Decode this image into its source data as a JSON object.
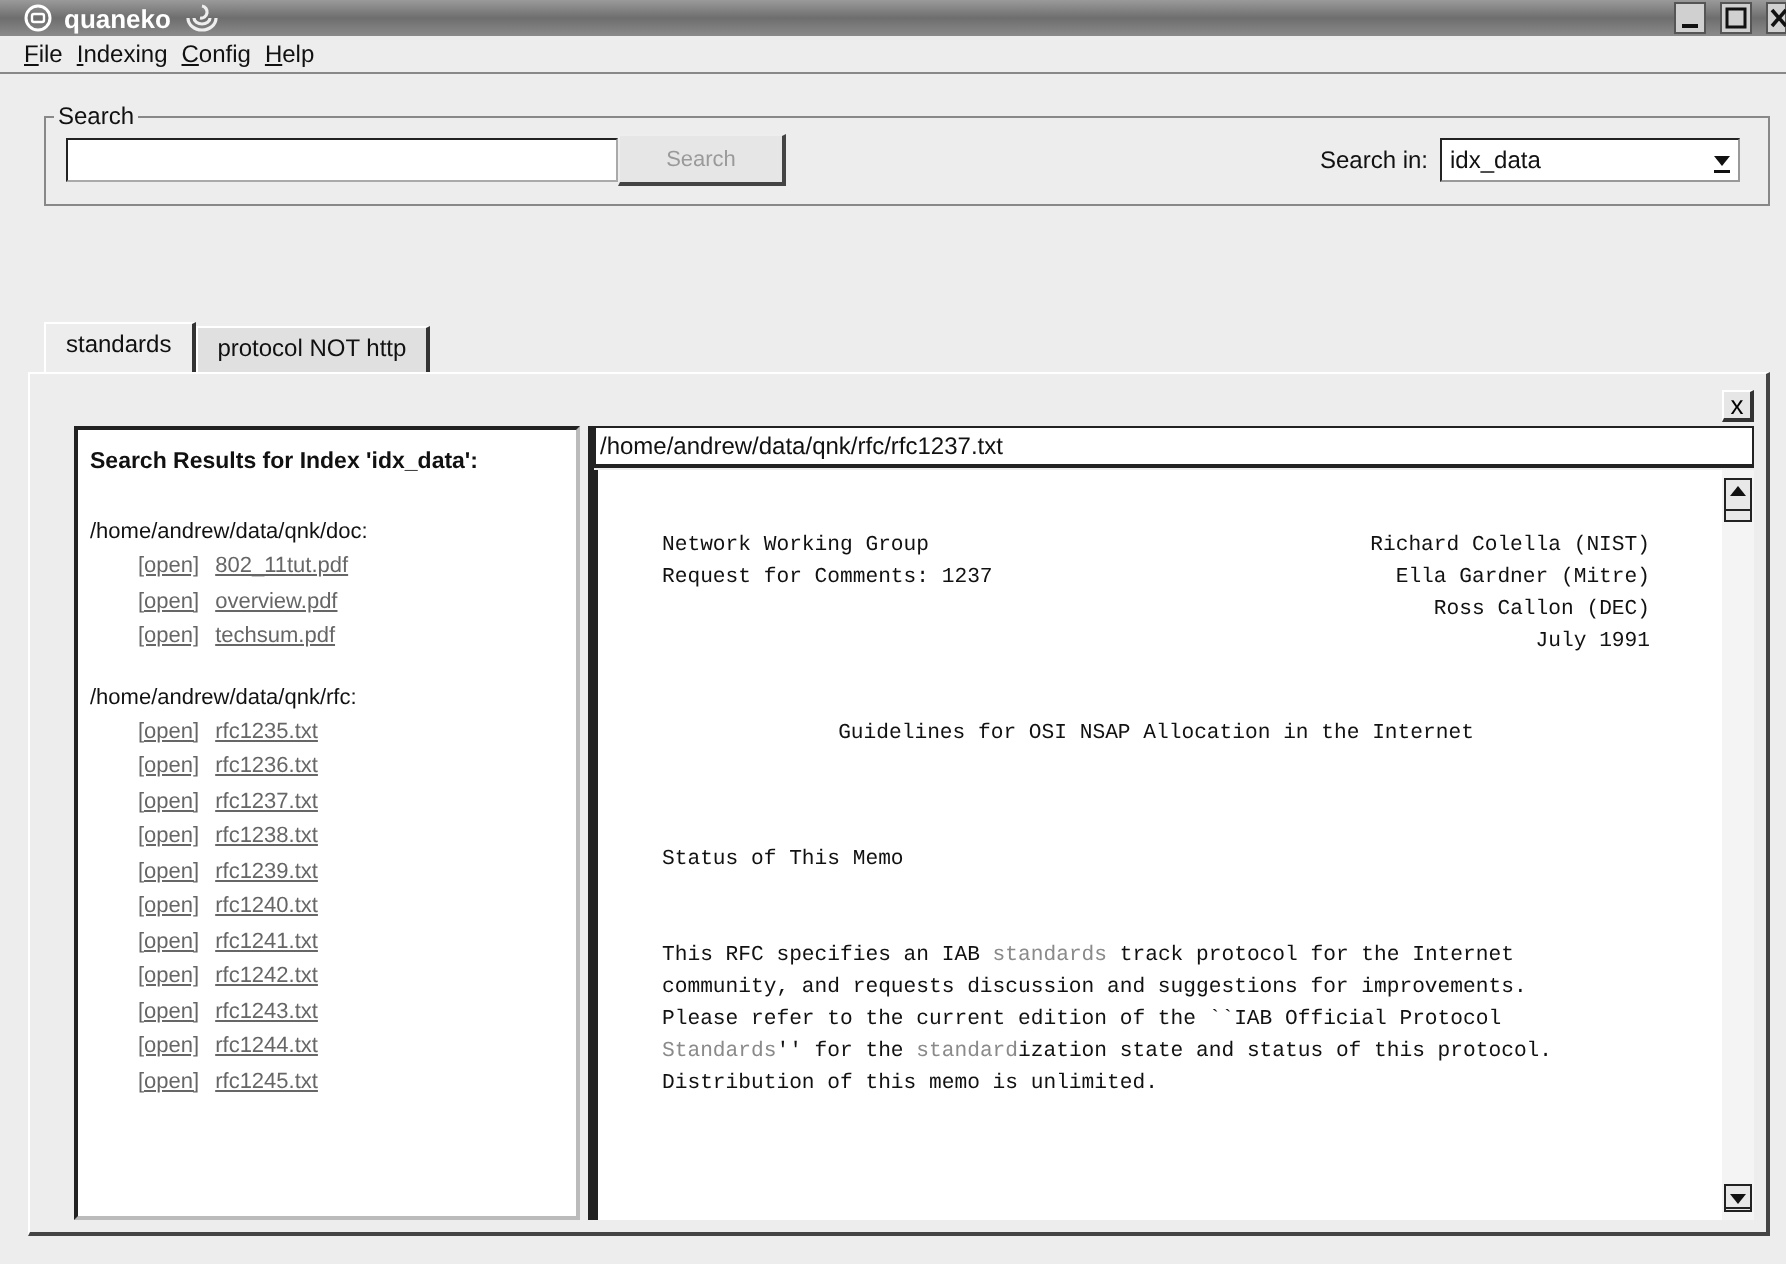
{
  "window": {
    "title": "quaneko"
  },
  "menu": [
    {
      "label": "File"
    },
    {
      "label": "Indexing"
    },
    {
      "label": "Config"
    },
    {
      "label": "Help"
    }
  ],
  "search": {
    "group_label": "Search",
    "button": {
      "label": "Search",
      "disabled": true
    },
    "scope_label": "Search in:",
    "scope_value": "idx_data"
  },
  "tabs": [
    {
      "label": "standards",
      "selected": true
    },
    {
      "label": "protocol NOT http",
      "selected": false
    }
  ],
  "close_tab": "x",
  "results": {
    "heading": "Search Results for Index 'idx_data':",
    "groups": [
      {
        "directory": "/home/andrew/data/qnk/doc:",
        "files": [
          {
            "action": "[open]",
            "name": "802_11tut.pdf"
          },
          {
            "action": "[open]",
            "name": "overview.pdf"
          },
          {
            "action": "[open]",
            "name": "techsum.pdf"
          }
        ]
      },
      {
        "directory": "/home/andrew/data/qnk/rfc:",
        "files": [
          {
            "action": "[open]",
            "name": "rfc1235.txt"
          },
          {
            "action": "[open]",
            "name": "rfc1236.txt"
          },
          {
            "action": "[open]",
            "name": "rfc1237.txt"
          },
          {
            "action": "[open]",
            "name": "rfc1238.txt"
          },
          {
            "action": "[open]",
            "name": "rfc1239.txt"
          },
          {
            "action": "[open]",
            "name": "rfc1240.txt"
          },
          {
            "action": "[open]",
            "name": "rfc1241.txt"
          },
          {
            "action": "[open]",
            "name": "rfc1242.txt"
          },
          {
            "action": "[open]",
            "name": "rfc1243.txt"
          },
          {
            "action": "[open]",
            "name": "rfc1244.txt"
          },
          {
            "action": "[open]",
            "name": "rfc1245.txt"
          }
        ]
      }
    ]
  },
  "document": {
    "path": "/home/andrew/data/qnk/rfc/rfc1237.txt",
    "blocks": [
      {
        "kind": "header",
        "rows": [
          {
            "left": "Network Working Group",
            "right": "Richard Colella (NIST)"
          },
          {
            "left": "Request for Comments: 1237",
            "right": "Ella Gardner (Mitre)"
          },
          {
            "right": "Ross Callon (DEC)"
          },
          {
            "right": "July 1991"
          }
        ]
      },
      {
        "kind": "title",
        "text": "Guidelines for OSI NSAP Allocation in the Internet"
      },
      {
        "kind": "heading",
        "text": "Status of This Memo"
      },
      {
        "kind": "paragraph",
        "lines": [
          [
            {
              "text": "This RFC specifies an IAB ",
              "hit": false
            },
            {
              "text": "standards",
              "hit": true
            },
            {
              "text": " track protocol for the Internet",
              "hit": false
            }
          ],
          [
            {
              "text": "community, and requests discussion and suggestions for improvements.",
              "hit": false
            }
          ],
          [
            {
              "text": "Please refer to the current edition of the ``IAB Official Protocol",
              "hit": false
            }
          ],
          [
            {
              "text": "Standards",
              "hit": true
            },
            {
              "text": "'' for the ",
              "hit": false
            },
            {
              "text": "standard",
              "hit": true
            },
            {
              "text": "ization state and status of this protocol.",
              "hit": false
            }
          ],
          [
            {
              "text": "Distribution of this memo is unlimited.",
              "hit": false
            }
          ]
        ]
      }
    ]
  }
}
